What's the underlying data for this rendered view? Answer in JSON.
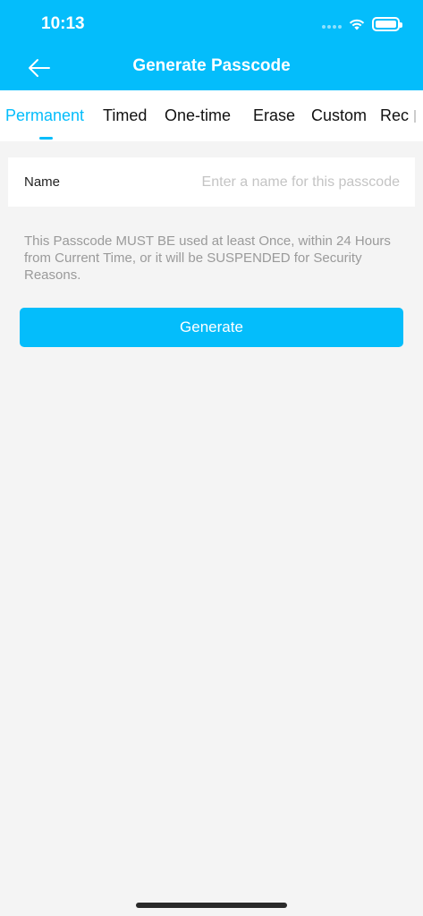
{
  "status_bar": {
    "time": "10:13",
    "icons": [
      "signal-icon",
      "wifi-icon",
      "battery-icon"
    ]
  },
  "nav": {
    "back_icon": "arrow-left-icon",
    "title": "Generate Passcode"
  },
  "tabs": [
    {
      "label": "Permanent",
      "active": true
    },
    {
      "label": "Timed",
      "active": false
    },
    {
      "label": "One-time",
      "active": false
    },
    {
      "label": "Erase",
      "active": false
    },
    {
      "label": "Custom",
      "active": false
    },
    {
      "label": "Rec",
      "active": false
    }
  ],
  "form": {
    "name_label": "Name",
    "name_value": "",
    "name_placeholder": "Enter a name for this passcode"
  },
  "notice": "This Passcode MUST BE used at least Once, within 24 Hours from Current Time, or it will be SUSPENDED for Security Reasons.",
  "generate_label": "Generate",
  "colors": {
    "accent": "#04bdfb",
    "background": "#f4f4f4",
    "notice_text": "#9a9a9a"
  }
}
